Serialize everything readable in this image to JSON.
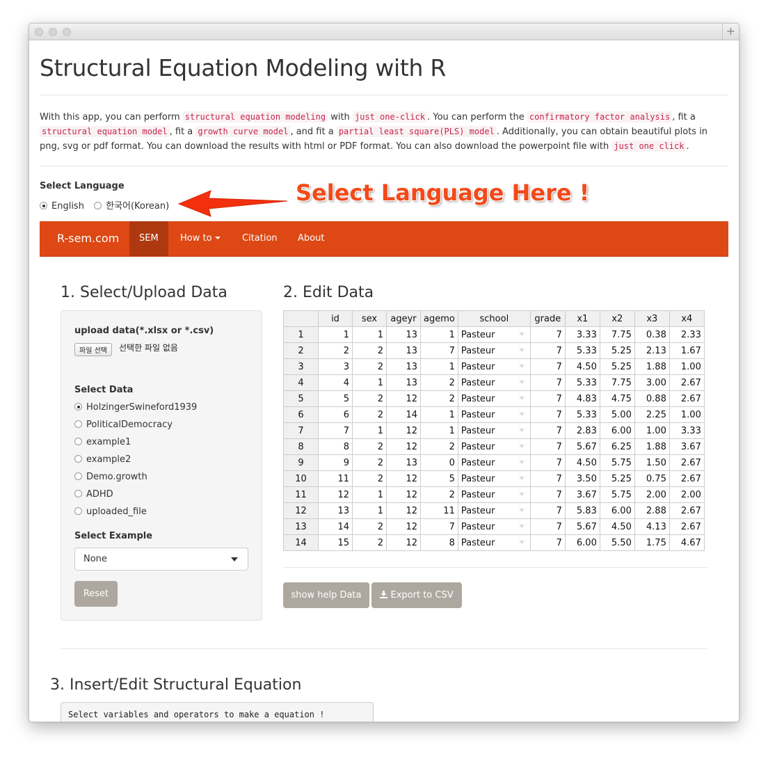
{
  "title": "Structural Equation Modeling with R",
  "intro": [
    {
      "t": "With this app, you can perform "
    },
    {
      "c": "structural equation modeling"
    },
    {
      "t": " with "
    },
    {
      "c": "just one-click"
    },
    {
      "t": ". You can perform the "
    },
    {
      "c": "confirmatory factor analysis"
    },
    {
      "t": ", fit a "
    },
    {
      "c": "structural equation model"
    },
    {
      "t": ", fit a "
    },
    {
      "c": "growth curve model"
    },
    {
      "t": ", and fit a "
    },
    {
      "c": "partial least square(PLS) model"
    },
    {
      "t": ". Additionally, you can obtain beautiful plots in png, svg or pdf format. You can download the results with html or PDF format. You can also download the powerpoint file with "
    },
    {
      "c": "just one click"
    },
    {
      "t": "."
    }
  ],
  "language": {
    "label": "Select Language",
    "options": [
      "English",
      "한국어(Korean)"
    ],
    "selected": "English"
  },
  "annotation": "Select Language Here !",
  "colors": {
    "navbar": "#dd4814",
    "nav_active": "#ae3910",
    "annotation": "#f24a1a"
  },
  "navbar": {
    "brand": "R-sem.com",
    "items": [
      "SEM",
      "How to",
      "Citation",
      "About"
    ],
    "active": "SEM"
  },
  "section1": {
    "title": "1. Select/Upload Data",
    "upload_label": "upload data(*.xlsx or *.csv)",
    "file_button": "파일 선택",
    "file_status": "선택한 파일 없음",
    "select_data_label": "Select Data",
    "datasets": [
      "HolzingerSwineford1939",
      "PoliticalDemocracy",
      "example1",
      "example2",
      "Demo.growth",
      "ADHD",
      "uploaded_file"
    ],
    "selected_dataset": "HolzingerSwineford1939",
    "select_example_label": "Select Example",
    "example_value": "None",
    "reset_button": "Reset"
  },
  "section2": {
    "title": "2. Edit Data",
    "columns": [
      "",
      "id",
      "sex",
      "ageyr",
      "agemo",
      "school",
      "grade",
      "x1",
      "x2",
      "x3",
      "x4"
    ],
    "rows": [
      [
        "1",
        "1",
        "1",
        "13",
        "1",
        "Pasteur",
        "7",
        "3.33",
        "7.75",
        "0.38",
        "2.33"
      ],
      [
        "2",
        "2",
        "2",
        "13",
        "7",
        "Pasteur",
        "7",
        "5.33",
        "5.25",
        "2.13",
        "1.67"
      ],
      [
        "3",
        "3",
        "2",
        "13",
        "1",
        "Pasteur",
        "7",
        "4.50",
        "5.25",
        "1.88",
        "1.00"
      ],
      [
        "4",
        "4",
        "1",
        "13",
        "2",
        "Pasteur",
        "7",
        "5.33",
        "7.75",
        "3.00",
        "2.67"
      ],
      [
        "5",
        "5",
        "2",
        "12",
        "2",
        "Pasteur",
        "7",
        "4.83",
        "4.75",
        "0.88",
        "2.67"
      ],
      [
        "6",
        "6",
        "2",
        "14",
        "1",
        "Pasteur",
        "7",
        "5.33",
        "5.00",
        "2.25",
        "1.00"
      ],
      [
        "7",
        "7",
        "1",
        "12",
        "1",
        "Pasteur",
        "7",
        "2.83",
        "6.00",
        "1.00",
        "3.33"
      ],
      [
        "8",
        "8",
        "2",
        "12",
        "2",
        "Pasteur",
        "7",
        "5.67",
        "6.25",
        "1.88",
        "3.67"
      ],
      [
        "9",
        "9",
        "2",
        "13",
        "0",
        "Pasteur",
        "7",
        "4.50",
        "5.75",
        "1.50",
        "2.67"
      ],
      [
        "10",
        "11",
        "2",
        "12",
        "5",
        "Pasteur",
        "7",
        "3.50",
        "5.25",
        "0.75",
        "2.67"
      ],
      [
        "11",
        "12",
        "1",
        "12",
        "2",
        "Pasteur",
        "7",
        "3.67",
        "5.75",
        "2.00",
        "2.00"
      ],
      [
        "12",
        "13",
        "1",
        "12",
        "11",
        "Pasteur",
        "7",
        "5.83",
        "6.00",
        "2.88",
        "2.67"
      ],
      [
        "13",
        "14",
        "2",
        "12",
        "7",
        "Pasteur",
        "7",
        "5.67",
        "4.50",
        "4.13",
        "2.67"
      ],
      [
        "14",
        "15",
        "2",
        "12",
        "8",
        "Pasteur",
        "7",
        "6.00",
        "5.50",
        "1.75",
        "4.67"
      ]
    ],
    "help_button": "show help Data",
    "export_button": "Export to CSV"
  },
  "section3": {
    "title": "3. Insert/Edit Structural Equation",
    "placeholder": "Select variables and operators to make a equation !"
  }
}
